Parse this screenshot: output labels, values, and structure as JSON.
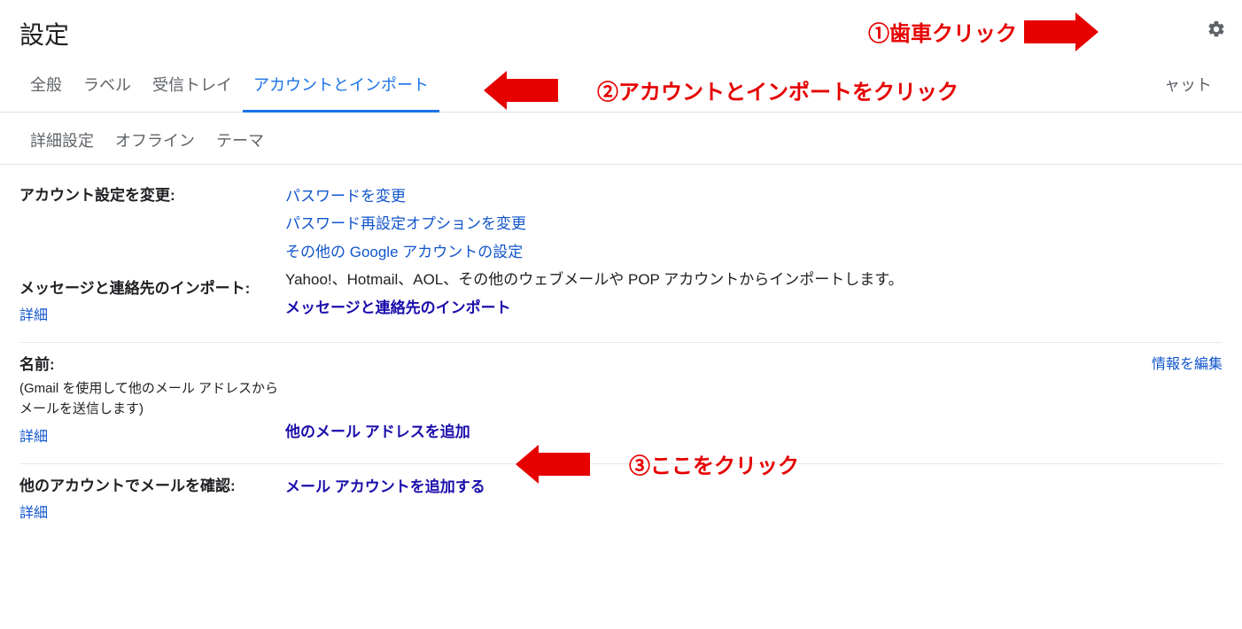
{
  "header": {
    "title": "設定"
  },
  "annotations": {
    "a1": "①歯車クリック",
    "a2": "②アカウントとインポートをクリック",
    "a3": "③ここをクリック"
  },
  "tabs": {
    "row1": {
      "general": "全般",
      "labels": "ラベル",
      "inbox": "受信トレイ",
      "accounts": "アカウントとインポート",
      "chat_fragment": "ャット"
    },
    "row2": {
      "advanced": "詳細設定",
      "offline": "オフライン",
      "themes": "テーマ"
    }
  },
  "sections": {
    "account_change": {
      "label": "アカウント設定を変更:",
      "links": {
        "pw": "パスワードを変更",
        "pw_reset": "パスワード再設定オプションを変更",
        "other_google": "その他の Google アカウントの設定"
      }
    },
    "import": {
      "label": "メッセージと連絡先のインポート:",
      "desc": "Yahoo!、Hotmail、AOL、その他のウェブメールや POP アカウントからインポートします。",
      "link": "メッセージと連絡先のインポート",
      "detail": "詳細"
    },
    "name": {
      "label": "名前:",
      "sub": "(Gmail を使用して他のメール アドレスからメールを送信します)",
      "link_add": "他のメール アドレスを追加",
      "link_edit": "情報を編集",
      "detail": "詳細"
    },
    "check_other": {
      "label": "他のアカウントでメールを確認:",
      "link": "メール アカウントを追加する",
      "detail": "詳細"
    }
  }
}
